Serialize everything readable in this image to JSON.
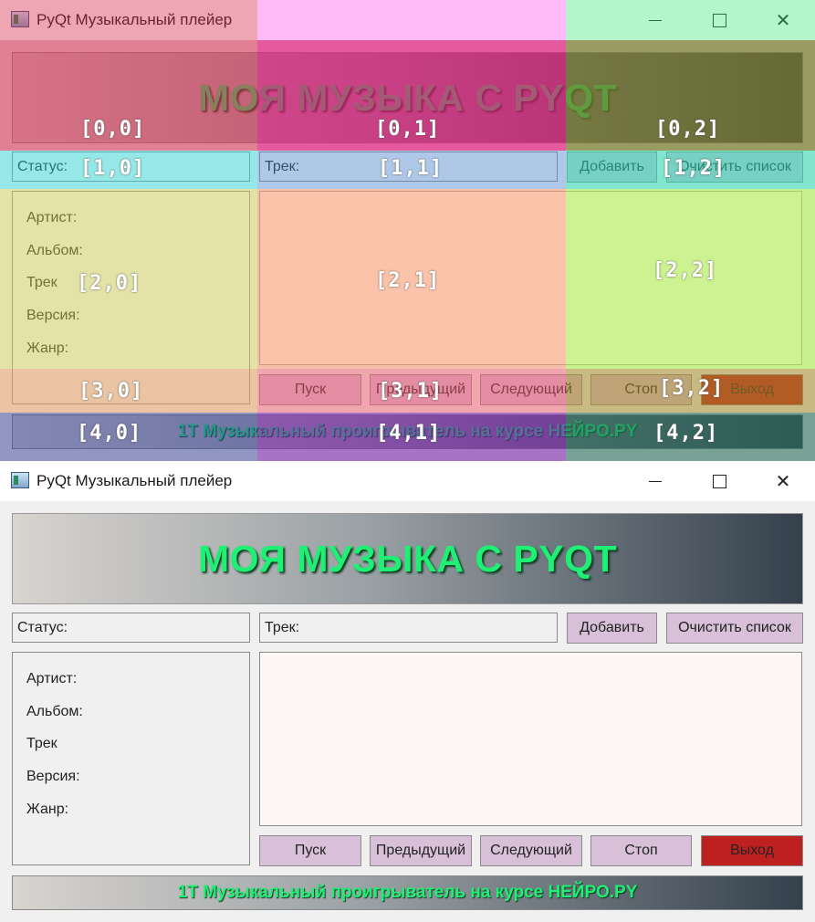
{
  "window": {
    "title": "PyQt Музыкальный плейер"
  },
  "header": {
    "text": "МОЯ МУЗЫКА С PYQT"
  },
  "status_label": "Статус:",
  "track_label": "Трек:",
  "buttons": {
    "add": "Добавить",
    "clear": "Очистить список",
    "play": "Пуск",
    "prev": "Предыдущий",
    "next": "Следующий",
    "stop": "Стоп",
    "exit": "Выход"
  },
  "info": {
    "artist": "Артист:",
    "album": "Альбом:",
    "track": "Трек",
    "version": "Версия:",
    "genre": "Жанр:"
  },
  "footer": {
    "text": "1Т Музыкальный проигрыватель на курсе НЕЙРО.PY"
  },
  "grid_labels": {
    "r0c0": "[0,0]",
    "r0c1": "[0,1]",
    "r0c2": "[0,2]",
    "r1c0": "[1,0]",
    "r1c1": "[1,1]",
    "r1c2": "[1,2]",
    "r2c0": "[2,0]",
    "r2c1": "[2,1]",
    "r2c2": "[2,2]",
    "r3c0": "[3,0]",
    "r3c1": "[3,1]",
    "r3c2": "[3,2]",
    "r4c0": "[4,0]",
    "r4c1": "[4,1]",
    "r4c2": "[4,2]"
  },
  "colors": {
    "accent_green": "#1fef74",
    "button_pink": "#d8c0d8",
    "exit_red": "#be2020"
  }
}
